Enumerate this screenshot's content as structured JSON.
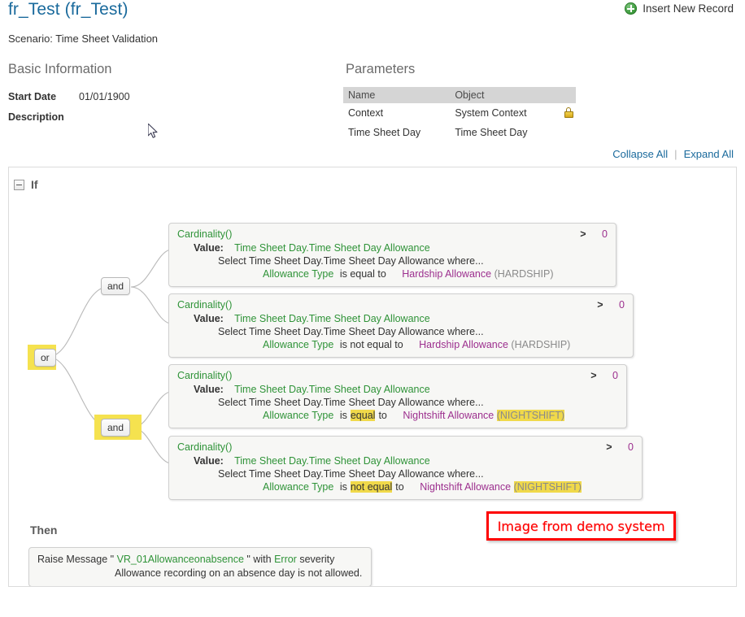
{
  "header": {
    "title": "fr_Test (fr_Test)",
    "insert_new_record": "Insert New Record",
    "scenario": "Scenario: Time Sheet Validation"
  },
  "basic_information": {
    "heading": "Basic Information",
    "start_date_label": "Start Date",
    "start_date_value": "01/01/1900",
    "description_label": "Description",
    "description_value": ""
  },
  "parameters": {
    "heading": "Parameters",
    "columns": [
      "Name",
      "Object"
    ],
    "rows": [
      {
        "name": "Context",
        "object": "System Context",
        "locked": true
      },
      {
        "name": "Time Sheet Day",
        "object": "Time Sheet Day",
        "locked": false
      }
    ]
  },
  "toolbar": {
    "collapse_all": "Collapse All",
    "expand_all": "Expand All",
    "divider": "|"
  },
  "rule": {
    "if_label": "If",
    "then_label": "Then",
    "operators": {
      "or": "or",
      "and_top": "and",
      "and_bottom": "and"
    },
    "conditions": [
      {
        "function": "Cardinality()",
        "operator": ">",
        "rhs_value": "0",
        "value_label": "Value:",
        "value_path": "Time Sheet Day.Time Sheet Day Allowance",
        "select_text": "Select Time Sheet Day.Time Sheet Day Allowance where...",
        "attribute": "Allowance Type",
        "comparator": "is equal to",
        "comparator_highlighted": false,
        "rhs_name": "Hardship Allowance",
        "rhs_code": "(HARDSHIP)",
        "rhs_code_highlighted": false
      },
      {
        "function": "Cardinality()",
        "operator": ">",
        "rhs_value": "0",
        "value_label": "Value:",
        "value_path": "Time Sheet Day.Time Sheet Day Allowance",
        "select_text": "Select Time Sheet Day.Time Sheet Day Allowance where...",
        "attribute": "Allowance Type",
        "comparator": "is not equal to",
        "comparator_highlighted": false,
        "rhs_name": "Hardship Allowance",
        "rhs_code": "(HARDSHIP)",
        "rhs_code_highlighted": false
      },
      {
        "function": "Cardinality()",
        "operator": ">",
        "rhs_value": "0",
        "value_label": "Value:",
        "value_path": "Time Sheet Day.Time Sheet Day Allowance",
        "select_text": "Select Time Sheet Day.Time Sheet Day Allowance where...",
        "attribute": "Allowance Type",
        "comparator": "is equal to",
        "comparator_highlighted": true,
        "comparator_prefix": "is",
        "comparator_mark": "equal",
        "comparator_suffix": "to",
        "rhs_name": "Nightshift Allowance",
        "rhs_code": "(NIGHTSHIFT)",
        "rhs_code_highlighted": true
      },
      {
        "function": "Cardinality()",
        "operator": ">",
        "rhs_value": "0",
        "value_label": "Value:",
        "value_path": "Time Sheet Day.Time Sheet Day Allowance",
        "select_text": "Select Time Sheet Day.Time Sheet Day Allowance where...",
        "attribute": "Allowance Type",
        "comparator": "is not equal to",
        "comparator_highlighted": true,
        "comparator_prefix": "is",
        "comparator_mark": "not equal",
        "comparator_suffix": "to",
        "rhs_name": "Nightshift Allowance",
        "rhs_code": "(NIGHTSHIFT)",
        "rhs_code_highlighted": true
      }
    ],
    "action": {
      "verb": "Raise Message",
      "quote_open": "\"",
      "message_code": "VR_01Allowanceonabsence",
      "quote_close": "\"",
      "with_word": "with",
      "severity": "Error",
      "severity_word": "severity",
      "message_text": "Allowance recording on an absence day is not allowed."
    }
  },
  "annotation": {
    "demo_text": "Image from demo system"
  },
  "colors": {
    "title_blue": "#1a6a9c",
    "link_blue": "#1a6a9c",
    "green": "#2f9338",
    "magenta": "#9c2f8e",
    "highlight_yellow": "#f0d94a",
    "node_highlight": "#f5e24f",
    "annotation_red": "#fe0000"
  }
}
